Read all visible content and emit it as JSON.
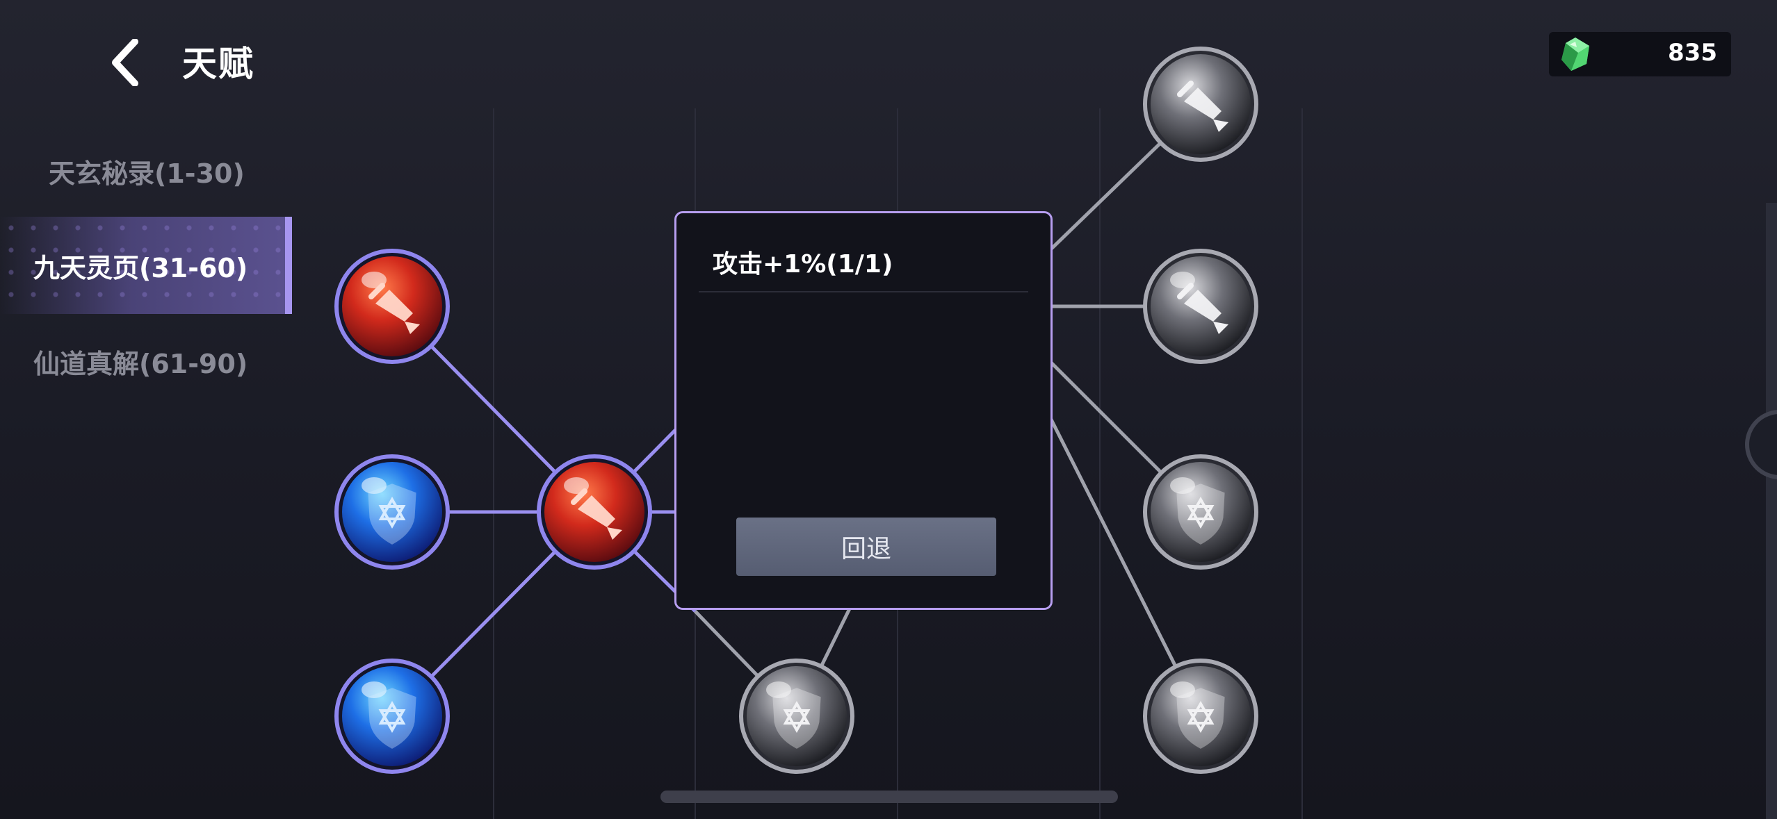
{
  "header": {
    "title": "天赋",
    "currency_amount": "835"
  },
  "sidebar": {
    "items": [
      {
        "label": "天玄秘录(1-30)",
        "active": false
      },
      {
        "label": "九天灵页(31-60)",
        "active": true
      },
      {
        "label": "仙道真解(61-90)",
        "active": false
      }
    ]
  },
  "tooltip": {
    "title": "攻击+1%(1/1)",
    "rollback_label": "回退"
  },
  "nodes": [
    {
      "id": "n1",
      "type": "sword",
      "state": "red"
    },
    {
      "id": "n2",
      "type": "shield",
      "state": "blue"
    },
    {
      "id": "n3",
      "type": "shield",
      "state": "blue"
    },
    {
      "id": "n4",
      "type": "sword",
      "state": "red"
    },
    {
      "id": "n5",
      "type": "shield",
      "state": "grey"
    },
    {
      "id": "n6",
      "type": "sword",
      "state": "grey"
    },
    {
      "id": "n7",
      "type": "sword",
      "state": "grey"
    },
    {
      "id": "n8",
      "type": "shield",
      "state": "grey"
    },
    {
      "id": "n9",
      "type": "shield",
      "state": "grey"
    }
  ],
  "colors": {
    "accent": "#a796f0",
    "active_link": "#9a8ff0",
    "inactive_link": "#a0a2ac",
    "tooltip_border": "#b79ef0"
  }
}
